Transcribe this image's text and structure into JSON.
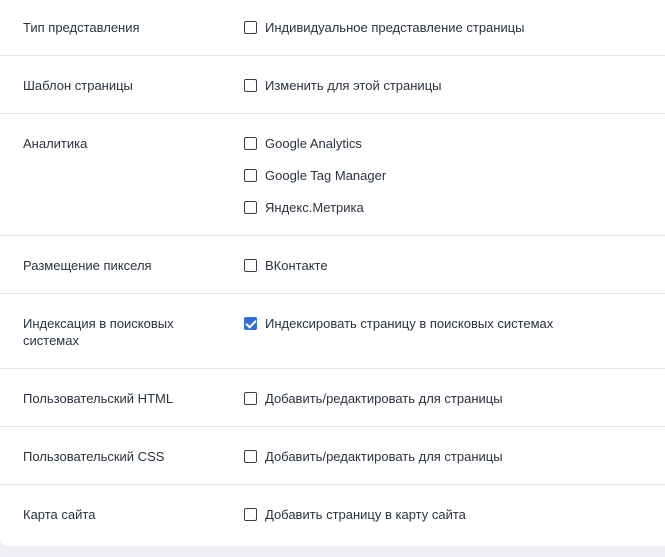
{
  "settings": [
    {
      "label": "Тип представления",
      "options": [
        {
          "text": "Индивидуальное представление страницы",
          "checked": false
        }
      ]
    },
    {
      "label": "Шаблон страницы",
      "options": [
        {
          "text": "Изменить для этой страницы",
          "checked": false
        }
      ]
    },
    {
      "label": "Аналитика",
      "options": [
        {
          "text": "Google Analytics",
          "checked": false
        },
        {
          "text": "Google Tag Manager",
          "checked": false
        },
        {
          "text": "Яндекс.Метрика",
          "checked": false
        }
      ]
    },
    {
      "label": "Размещение пикселя",
      "options": [
        {
          "text": "ВКонтакте",
          "checked": false
        }
      ]
    },
    {
      "label": "Индексация в поисковых системах",
      "options": [
        {
          "text": "Индексировать страницу в поисковых системах",
          "checked": true
        }
      ]
    },
    {
      "label": "Пользовательский HTML",
      "options": [
        {
          "text": "Добавить/редактировать для страницы",
          "checked": false
        }
      ]
    },
    {
      "label": "Пользовательский CSS",
      "options": [
        {
          "text": "Добавить/редактировать для страницы",
          "checked": false
        }
      ]
    },
    {
      "label": "Карта сайта",
      "options": [
        {
          "text": "Добавить страницу в карту сайта",
          "checked": false
        }
      ]
    }
  ],
  "colors": {
    "accent": "#2f6fd6",
    "divider": "#e3e6ea",
    "text": "#2a3340"
  }
}
